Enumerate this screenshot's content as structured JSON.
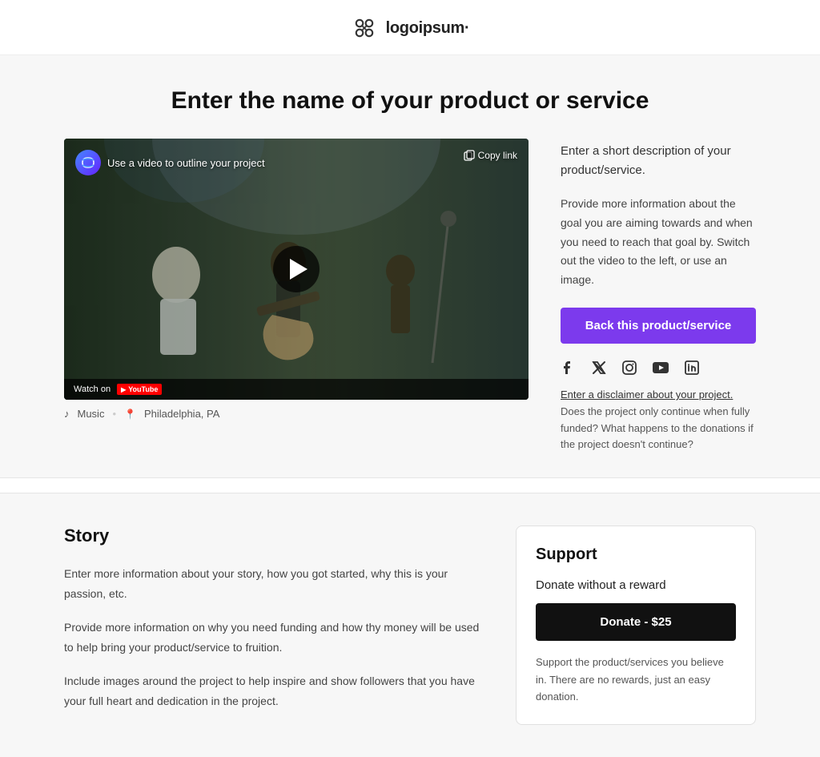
{
  "header": {
    "logo_text": "logoipsum·",
    "logo_icon_label": "logoipsum-icon"
  },
  "hero": {
    "title": "Enter the name of your product or service",
    "video": {
      "label": "Use a video to outline your project",
      "channel_icon_text": "◎",
      "copy_link_text": "Copy link",
      "watch_on_text": "Watch on",
      "youtube_text": "YouTube",
      "play_button_label": "play-button"
    },
    "meta": {
      "category": "Music",
      "location": "Philadelphia, PA"
    },
    "info": {
      "short_desc": "Enter a short description of your product/service.",
      "long_desc": "Provide more information about the goal you are aiming towards and when you need to reach that goal by. Switch out the video to the left, or use an image.",
      "back_button": "Back this product/service",
      "disclaimer_link": "Enter a disclaimer about your project.",
      "disclaimer_text": " Does the project only continue when fully funded? What happens to the donations if the project doesn't continue?"
    },
    "social": {
      "facebook": "f",
      "twitter": "𝕏",
      "instagram": "⊙",
      "youtube": "▶",
      "linkedin": "in"
    }
  },
  "story": {
    "title": "Story",
    "paragraphs": [
      "Enter more information about your story, how you got started, why this is your passion, etc.",
      "Provide more information on why you need funding and how thy money will be used to help bring your product/service to fruition.",
      "Include images around the project to help inspire and show followers that you have your full heart and dedication in the project."
    ]
  },
  "support": {
    "title": "Support",
    "donate_without_reward_label": "Donate without a reward",
    "donate_button": "Donate - $25",
    "donate_description": "Support the product/services you believe in. There are no rewards, just an easy donation."
  }
}
